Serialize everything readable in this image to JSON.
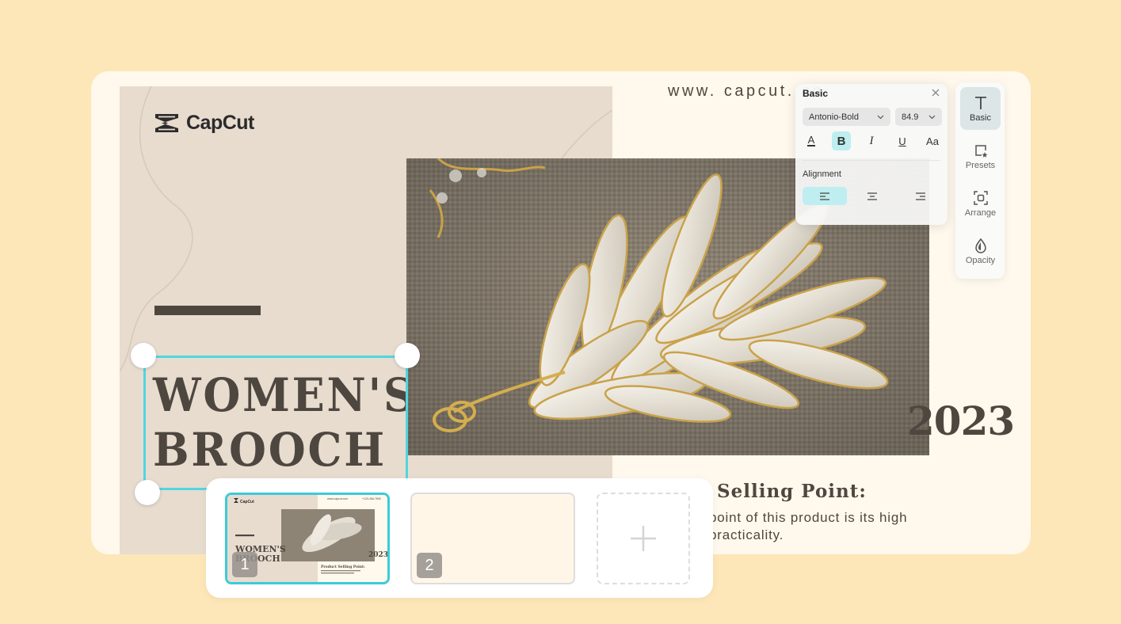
{
  "design": {
    "brand_name": "CapCut",
    "url_text": "www. capcut. co",
    "title_line1": "WOMEN'S",
    "title_line2": "BROOCH",
    "year": "2023",
    "selling_point_heading": "Selling Point:",
    "selling_point_line1": "point of this product is its high",
    "selling_point_line2": "practicality."
  },
  "basic_panel": {
    "title": "Basic",
    "font_name": "Antonio-Bold",
    "font_size": "84.9",
    "bold_label": "B",
    "italic_label": "I",
    "underline_label": "U",
    "case_label": "Aa",
    "color_label": "A",
    "alignment_label": "Alignment",
    "active_alignment": "left"
  },
  "toolbar": {
    "items": [
      {
        "label": "Basic",
        "icon": "text-icon",
        "active": true
      },
      {
        "label": "Presets",
        "icon": "presets-icon",
        "active": false
      },
      {
        "label": "Arrange",
        "icon": "arrange-icon",
        "active": false
      },
      {
        "label": "Opacity",
        "icon": "opacity-icon",
        "active": false
      }
    ]
  },
  "pages": {
    "items": [
      {
        "number": "1",
        "active": true
      },
      {
        "number": "2",
        "active": false
      }
    ],
    "thumb1": {
      "url": "www.capcut.com",
      "phone": "+123-456-7890",
      "title_line1": "WOMEN'S",
      "title_line2": "BROOCH",
      "year": "2023",
      "heading": "Product Selling Point:"
    }
  },
  "colors": {
    "background": "#FDE7B8",
    "card": "#FFF8EC",
    "panel": "#E8DCCF",
    "text_dark": "#4E4740",
    "accent": "#3CCAD8",
    "selection": "#4FD6E1"
  }
}
